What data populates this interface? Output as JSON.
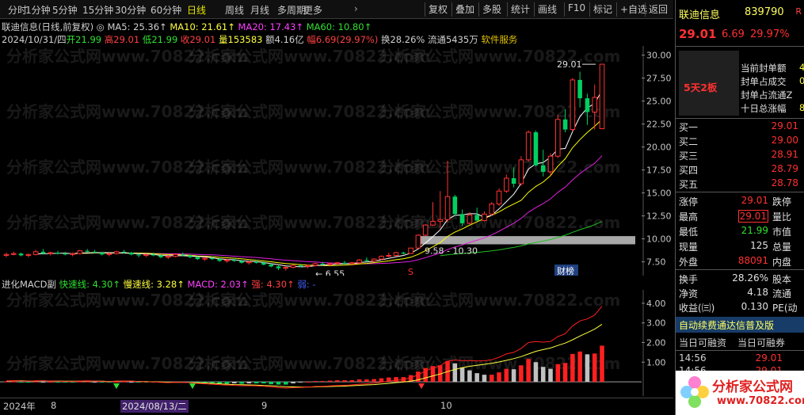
{
  "periods": [
    "分时",
    "1分钟",
    "5分钟",
    "15分钟",
    "30分钟",
    "60分钟",
    "日线",
    "周线",
    "月线",
    "多周期",
    "更多"
  ],
  "active_period": "日线",
  "tools": [
    "复权",
    "叠加",
    "多股",
    "统计",
    "画线",
    "F10",
    "标记",
    "+自选",
    "返回"
  ],
  "title_line": {
    "stock": "联迪信息(日线,前复权)",
    "ma5": "MA5: 25.36↑",
    "ma10": "MA10: 21.61↑",
    "ma20": "MA20: 17.43↑",
    "ma60": "MA60: 10.80↑"
  },
  "info_line": {
    "date": "2024/10/31/四",
    "open": "开21.99",
    "high": "高29.01",
    "low": "低21.99",
    "close": "收29.01",
    "vol": "量153583",
    "amt": "额4.16亿",
    "amp": "幅6.69(29.97%)",
    "turn": "换28.26%",
    "float": "流通5435万",
    "sector": "软件服务"
  },
  "price_axis": [
    "30.00",
    "27.50",
    "25.00",
    "22.50",
    "20.00",
    "17.50",
    "15.00",
    "12.50",
    "10.00",
    "7.50"
  ],
  "chart_labels": {
    "high": "29.01",
    "low": "6.55",
    "range": "9.58 - 10.30",
    "event": "财榜",
    "marker": "S"
  },
  "macd_header": {
    "name": "进化MACD副",
    "fast": "快速线: 4.30↑",
    "slow": "慢速线: 3.28↑",
    "macd": "MACD: 2.03↑",
    "strong": "强: 4.30↑",
    "weak": "弱: -"
  },
  "macd_axis": [
    "4.00",
    "3.00",
    "2.00",
    "1.00"
  ],
  "date_axis": {
    "year": "2024年",
    "m8": "8",
    "sel": "2024/08/13/二",
    "m9": "9",
    "m10": "10"
  },
  "colors": {
    "up": "#ff3232",
    "down": "#00d060",
    "ma5": "#ffffff",
    "ma10": "#ffff00",
    "ma20": "#e020e0",
    "ma60": "#20c020"
  },
  "chart_data": {
    "type": "candlestick",
    "ylim": [
      6,
      31
    ],
    "candles": [
      [
        8.2,
        8.5,
        8.0,
        8.3
      ],
      [
        8.3,
        8.6,
        8.2,
        8.4
      ],
      [
        8.4,
        8.5,
        8.1,
        8.2
      ],
      [
        8.2,
        8.4,
        8.0,
        8.3
      ],
      [
        8.3,
        8.8,
        8.2,
        8.6
      ],
      [
        8.6,
        8.9,
        8.3,
        8.4
      ],
      [
        8.4,
        8.6,
        8.2,
        8.5
      ],
      [
        8.5,
        8.7,
        8.3,
        8.4
      ],
      [
        8.4,
        8.6,
        8.2,
        8.3
      ],
      [
        8.3,
        8.5,
        8.1,
        8.4
      ],
      [
        8.4,
        8.8,
        8.3,
        8.7
      ],
      [
        8.7,
        8.9,
        8.5,
        8.6
      ],
      [
        8.6,
        8.8,
        8.4,
        8.5
      ],
      [
        8.5,
        8.6,
        8.2,
        8.3
      ],
      [
        8.3,
        8.5,
        8.1,
        8.4
      ],
      [
        8.4,
        8.7,
        8.3,
        8.6
      ],
      [
        8.6,
        8.8,
        8.4,
        8.5
      ],
      [
        8.5,
        8.6,
        8.2,
        8.3
      ],
      [
        8.3,
        8.4,
        8.0,
        8.2
      ],
      [
        8.2,
        8.4,
        8.0,
        8.3
      ],
      [
        8.3,
        8.5,
        8.1,
        8.2
      ],
      [
        8.2,
        8.3,
        7.9,
        8.0
      ],
      [
        8.0,
        8.2,
        7.8,
        8.1
      ],
      [
        8.1,
        8.4,
        8.0,
        8.3
      ],
      [
        8.3,
        8.5,
        8.1,
        8.2
      ],
      [
        8.2,
        8.3,
        7.9,
        8.0
      ],
      [
        8.0,
        8.1,
        7.7,
        7.8
      ],
      [
        7.8,
        8.0,
        7.6,
        7.9
      ],
      [
        7.9,
        8.1,
        7.7,
        7.8
      ],
      [
        7.8,
        7.9,
        7.5,
        7.6
      ],
      [
        7.6,
        7.8,
        7.4,
        7.7
      ],
      [
        7.7,
        7.9,
        7.5,
        7.6
      ],
      [
        7.6,
        7.7,
        7.3,
        7.4
      ],
      [
        7.4,
        7.6,
        7.2,
        7.5
      ],
      [
        7.5,
        7.7,
        7.3,
        7.4
      ],
      [
        7.4,
        7.5,
        7.1,
        7.2
      ],
      [
        7.2,
        7.3,
        6.9,
        7.0
      ],
      [
        7.0,
        7.1,
        6.6,
        6.8
      ],
      [
        6.8,
        7.0,
        6.55,
        6.9
      ],
      [
        6.9,
        7.2,
        6.8,
        7.1
      ],
      [
        7.1,
        7.3,
        6.9,
        7.0
      ],
      [
        7.0,
        7.2,
        6.8,
        7.1
      ],
      [
        7.1,
        7.4,
        7.0,
        7.3
      ],
      [
        7.3,
        7.5,
        7.1,
        7.2
      ],
      [
        7.2,
        7.4,
        7.0,
        7.3
      ],
      [
        7.3,
        7.5,
        7.2,
        7.4
      ],
      [
        7.4,
        7.6,
        7.2,
        7.3
      ],
      [
        7.3,
        7.5,
        7.1,
        7.4
      ],
      [
        7.4,
        7.8,
        7.3,
        7.7
      ],
      [
        7.7,
        8.0,
        7.5,
        7.6
      ],
      [
        7.6,
        7.9,
        7.5,
        7.8
      ],
      [
        7.8,
        8.2,
        7.7,
        8.1
      ],
      [
        8.1,
        8.5,
        8.0,
        8.2
      ],
      [
        8.2,
        8.6,
        8.1,
        8.5
      ],
      [
        8.5,
        8.6,
        8.3,
        8.4
      ],
      [
        8.4,
        9.0,
        8.4,
        9.0
      ],
      [
        9.0,
        10.5,
        8.9,
        10.4
      ],
      [
        10.4,
        11.6,
        10.3,
        11.5
      ],
      [
        11.5,
        14.0,
        11.4,
        11.9
      ],
      [
        11.9,
        15.2,
        11.2,
        12.1
      ],
      [
        12.1,
        18.5,
        11.8,
        14.6
      ],
      [
        14.6,
        14.8,
        12.5,
        12.7
      ],
      [
        12.7,
        13.2,
        11.4,
        11.7
      ],
      [
        11.7,
        12.9,
        11.6,
        12.6
      ],
      [
        12.6,
        13.4,
        11.9,
        12.0
      ],
      [
        12.0,
        13.0,
        11.9,
        12.7
      ],
      [
        12.7,
        14.0,
        12.5,
        13.8
      ],
      [
        13.8,
        15.5,
        13.6,
        15.2
      ],
      [
        15.2,
        17.0,
        15.0,
        16.6
      ],
      [
        16.6,
        17.8,
        15.6,
        16.0
      ],
      [
        16.0,
        19.0,
        15.8,
        18.6
      ],
      [
        18.6,
        21.8,
        18.4,
        21.6
      ],
      [
        21.6,
        21.8,
        17.9,
        18.0
      ],
      [
        18.0,
        19.7,
        16.8,
        17.3
      ],
      [
        17.3,
        19.3,
        16.9,
        19.0
      ],
      [
        19.0,
        23.5,
        18.8,
        23.0
      ],
      [
        23.0,
        24.1,
        21.6,
        21.9
      ],
      [
        21.9,
        27.5,
        21.7,
        27.3
      ],
      [
        27.3,
        28.2,
        24.3,
        25.3
      ],
      [
        25.3,
        25.8,
        22.4,
        23.8
      ],
      [
        23.8,
        26.8,
        21.9,
        25.4
      ],
      [
        21.99,
        29.01,
        21.99,
        29.01
      ]
    ],
    "macd_dif": [
      0.05,
      0.06,
      0.04,
      0.03,
      0.05,
      0.05,
      0.04,
      0.03,
      0.02,
      0.02,
      0.04,
      0.05,
      0.04,
      0.02,
      0.01,
      0.03,
      0.04,
      0.03,
      0.01,
      0.0,
      -0.01,
      -0.03,
      -0.04,
      -0.03,
      -0.03,
      -0.05,
      -0.08,
      -0.1,
      -0.12,
      -0.15,
      -0.17,
      -0.18,
      -0.2,
      -0.2,
      -0.21,
      -0.23,
      -0.26,
      -0.3,
      -0.32,
      -0.3,
      -0.29,
      -0.27,
      -0.24,
      -0.23,
      -0.21,
      -0.19,
      -0.18,
      -0.16,
      -0.12,
      -0.1,
      -0.07,
      -0.02,
      0.03,
      0.08,
      0.11,
      0.2,
      0.36,
      0.55,
      0.7,
      0.82,
      1.05,
      1.1,
      1.08,
      1.08,
      1.06,
      1.07,
      1.12,
      1.25,
      1.42,
      1.5,
      1.7,
      2.0,
      2.05,
      2.02,
      2.05,
      2.3,
      2.45,
      2.85,
      3.1,
      3.2,
      3.4,
      3.85
    ],
    "macd_dea": [
      0.04,
      0.05,
      0.05,
      0.04,
      0.04,
      0.05,
      0.04,
      0.04,
      0.03,
      0.03,
      0.03,
      0.04,
      0.04,
      0.03,
      0.02,
      0.03,
      0.03,
      0.03,
      0.02,
      0.01,
      0.0,
      -0.01,
      -0.02,
      -0.03,
      -0.03,
      -0.04,
      -0.05,
      -0.06,
      -0.08,
      -0.1,
      -0.12,
      -0.14,
      -0.15,
      -0.16,
      -0.17,
      -0.19,
      -0.2,
      -0.23,
      -0.25,
      -0.26,
      -0.27,
      -0.27,
      -0.26,
      -0.25,
      -0.24,
      -0.23,
      -0.22,
      -0.2,
      -0.18,
      -0.16,
      -0.14,
      -0.11,
      -0.08,
      -0.04,
      -0.01,
      0.03,
      0.1,
      0.2,
      0.3,
      0.4,
      0.52,
      0.63,
      0.72,
      0.79,
      0.84,
      0.89,
      0.94,
      1.01,
      1.09,
      1.18,
      1.28,
      1.42,
      1.55,
      1.64,
      1.72,
      1.85,
      1.97,
      2.14,
      2.33,
      2.5,
      2.68,
      2.93
    ],
    "macd_hist": [
      0.02,
      0.02,
      -0.02,
      -0.02,
      0.02,
      0.0,
      0.0,
      -0.02,
      -0.02,
      -0.02,
      0.02,
      0.02,
      0.0,
      -0.02,
      -0.02,
      0.0,
      0.02,
      0.0,
      -0.02,
      -0.02,
      -0.02,
      -0.04,
      -0.04,
      0.0,
      0.0,
      -0.02,
      -0.06,
      -0.08,
      -0.08,
      -0.1,
      -0.1,
      -0.08,
      -0.1,
      -0.08,
      -0.08,
      -0.08,
      -0.12,
      -0.14,
      -0.14,
      -0.08,
      -0.04,
      0.0,
      0.04,
      0.04,
      0.06,
      0.08,
      0.08,
      0.08,
      0.12,
      0.12,
      0.14,
      0.18,
      0.22,
      0.24,
      0.24,
      0.34,
      0.52,
      0.7,
      0.8,
      0.84,
      1.06,
      0.94,
      0.72,
      0.58,
      0.44,
      0.36,
      0.36,
      0.48,
      0.66,
      0.64,
      0.84,
      1.16,
      1.0,
      0.76,
      0.66,
      0.9,
      0.96,
      1.42,
      1.54,
      1.4,
      1.44,
      1.84
    ]
  },
  "right_panel": {
    "name": "联迪信息",
    "code": "839790",
    "r_mark": "R",
    "price": "29.01",
    "change": "6.69",
    "pct": "29.97%",
    "board_text": "5天2板",
    "limit_info": [
      {
        "k": "当前封单额",
        "v": "4"
      },
      {
        "k": "封单占成交",
        "v": "0"
      },
      {
        "k": "封单占流通Z",
        "v": ""
      },
      {
        "k": "十日总涨幅",
        "v": "8"
      }
    ],
    "bids": [
      {
        "k": "买一",
        "v": "29.01"
      },
      {
        "k": "买二",
        "v": "29.00"
      },
      {
        "k": "买三",
        "v": "28.91"
      },
      {
        "k": "买四",
        "v": "28.79"
      },
      {
        "k": "买五",
        "v": "28.78"
      }
    ],
    "stats": [
      {
        "k1": "涨停",
        "v1": "29.01",
        "k2": "跌停"
      },
      {
        "k1": "最高",
        "v1": "29.01",
        "k2": "量比"
      },
      {
        "k1": "最低",
        "v1": "21.99",
        "k2": "市值"
      },
      {
        "k1": "现量",
        "v1": "125",
        "k2": "总量"
      },
      {
        "k1": "外盘",
        "v1": "88091",
        "k2": "内盘"
      }
    ],
    "fin": [
      {
        "k1": "换手",
        "v1": "28.26%",
        "k2": "股本"
      },
      {
        "k1": "净资",
        "v1": "4.18",
        "k2": "流通"
      },
      {
        "k1": "收益(㈢)",
        "v1": "0.130",
        "k2": "PE(动"
      }
    ],
    "banner": "自动续费通达信普及版",
    "margin_head": [
      "当日可融资",
      "当日可融券"
    ],
    "ticks": [
      {
        "t": "14:56",
        "p": "29.01"
      },
      {
        "t": "14:56",
        "p": "29.01"
      }
    ],
    "logo_text": "分析家公式网",
    "logo_url": "www.70822.com"
  },
  "watermark": "分析家公式网www.70822.com"
}
